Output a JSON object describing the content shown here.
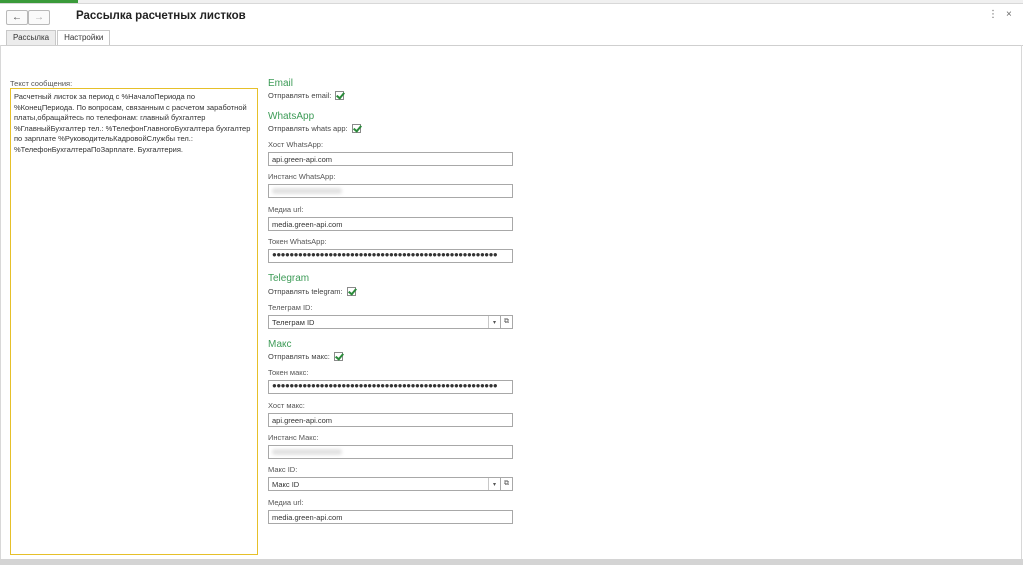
{
  "window": {
    "title": "Рассылка расчетных листков",
    "back_icon": "←",
    "forward_icon": "→",
    "more_icon": "⋮",
    "close_icon": "×"
  },
  "tabs": [
    {
      "label": "Рассылка",
      "active": false
    },
    {
      "label": "Настройки",
      "active": true
    }
  ],
  "message": {
    "label": "Текст сообщения:",
    "text": "Расчетный листок за период с %НачалоПериода по %КонецПериода. По вопросам, связанным с расчетом заработной платы,обращайтесь по телефонам: главный бухгалтер %ГлавныйБухгалтер тел.: %ТелефонГлавногоБухгалтера бухгалтер по зарплате %РуководительКадровойСлужбы тел.: %ТелефонБухгалтераПоЗарплате. Бухгалтерия."
  },
  "email": {
    "heading": "Email",
    "send_label": "Отправлять email:",
    "send_checked": true
  },
  "whatsapp": {
    "heading": "WhatsApp",
    "send_label": "Отправлять whats app:",
    "send_checked": true,
    "host_label": "Хост WhatsApp:",
    "host_value": "api.green-api.com",
    "instance_label": "Инстанс WhatsApp:",
    "media_label": "Медиа url:",
    "media_value": "media.green-api.com",
    "token_label": "Токен WhatsApp:",
    "token_value": "●●●●●●●●●●●●●●●●●●●●●●●●●●●●●●●●●●●●●●●●●●●●●●●●●●●●"
  },
  "telegram": {
    "heading": "Telegram",
    "send_label": "Отправлять telegram:",
    "send_checked": true,
    "id_label": "Телеграм ID:",
    "id_value": "Телеграм ID"
  },
  "max": {
    "heading": "Макс",
    "send_label": "Отправлять макс:",
    "send_checked": true,
    "token_label": "Токен макс:",
    "token_value": "●●●●●●●●●●●●●●●●●●●●●●●●●●●●●●●●●●●●●●●●●●●●●●●●●●●●",
    "host_label": "Хост макс:",
    "host_value": "api.green-api.com",
    "instance_label": "Инстанс Макс:",
    "id_label": "Макс ID:",
    "id_value": "Макс ID",
    "media_label": "Медиа url:",
    "media_value": "media.green-api.com"
  },
  "icons": {
    "dropdown": "▾",
    "open": "⧉"
  },
  "colors": {
    "section_heading": "#3d9b57",
    "message_border": "#e6c02a",
    "check": "#2a8a3a"
  }
}
